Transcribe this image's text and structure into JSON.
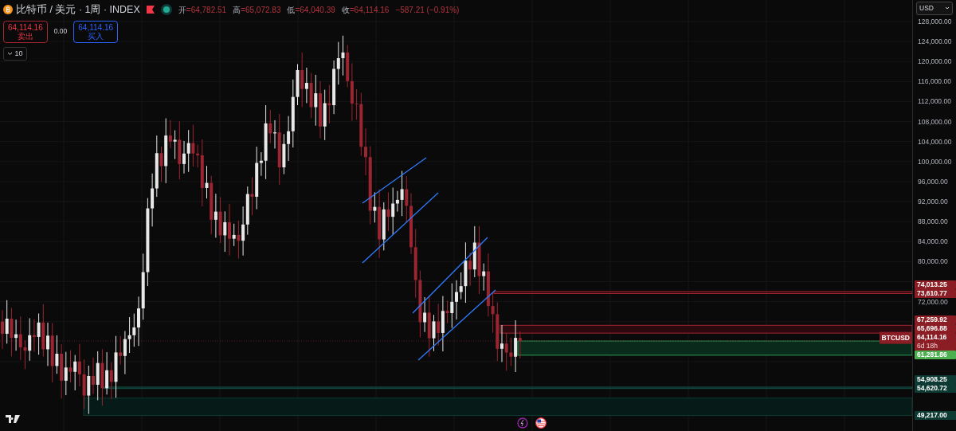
{
  "header": {
    "symbol": "比特币 / 美元 · 1周 · INDEX",
    "ohlc": [
      {
        "label": "开",
        "value": "=64,782.51"
      },
      {
        "label": "高",
        "value": "=65,072.83"
      },
      {
        "label": "低",
        "value": "=64,040.39"
      },
      {
        "label": "收",
        "value": "=64,114.16"
      }
    ],
    "change": "−587.21 (−0.91%)"
  },
  "trade": {
    "sell": {
      "price": "64,114.16",
      "label": "卖出"
    },
    "spread": "0.00",
    "buy": {
      "price": "64,114.16",
      "label": "买入"
    }
  },
  "indicators": {
    "count": "10"
  },
  "currency": "USD",
  "price_axis": {
    "ticks": [
      "128,000.00",
      "124,000.00",
      "120,000.00",
      "116,000.00",
      "112,000.00",
      "108,000.00",
      "104,000.00",
      "100,000.00",
      "96,000.00",
      "92,000.00",
      "88,000.00",
      "84,000.00",
      "80,000.00",
      "72,000.00"
    ]
  },
  "price_labels": [
    {
      "price": "74,013.25",
      "kind": "resistance"
    },
    {
      "price": "73,610.77",
      "kind": "resistance"
    },
    {
      "price": "67,259.92",
      "kind": "resistance"
    },
    {
      "price": "65,696.88",
      "kind": "resistance"
    },
    {
      "price": "64,114.16",
      "kind": "last",
      "symbol": "BTCUSD",
      "countdown": "6d 18h"
    },
    {
      "price": "61,281.86",
      "kind": "support"
    },
    {
      "price": "54,908.25",
      "kind": "zone"
    },
    {
      "price": "54,620.72",
      "kind": "zone"
    },
    {
      "price": "49,217.00",
      "kind": "zone"
    }
  ]
}
